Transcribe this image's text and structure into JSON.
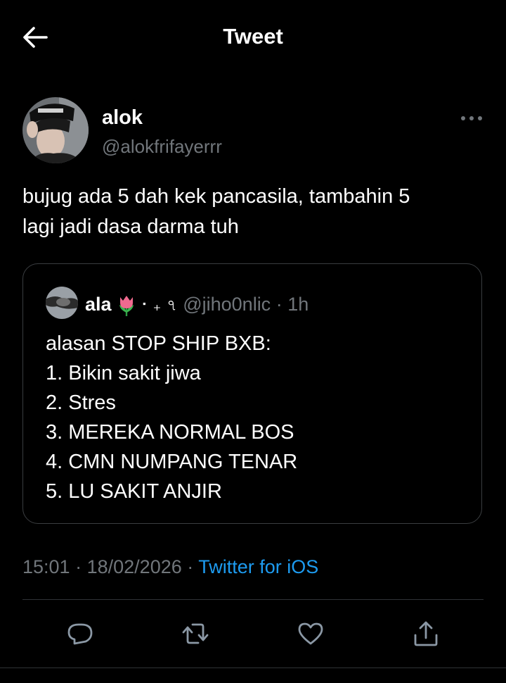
{
  "header": {
    "title": "Tweet",
    "back_icon": "arrow-left-icon"
  },
  "tweet": {
    "author": {
      "display_name": "alok",
      "handle": "@alokfrifayerrr"
    },
    "text_lines": [
      "bujug ada 5 dah kek pancasila, tambahin 5",
      "lagi jadi dasa darma tuh"
    ],
    "quoted": {
      "display_name": "ala",
      "name_decoration": "⠂₊ ৭",
      "emoji_icon": "tulip-icon",
      "handle": "@jiho0nlic",
      "separator": "·",
      "time": "1h",
      "lines": [
        "alasan STOP SHIP BXB:",
        "1. Bikin sakit jiwa",
        "2. Stres",
        "3. MEREKA NORMAL BOS",
        "4. CMN NUMPANG TENAR",
        "5. LU SAKIT ANJIR"
      ]
    },
    "meta": {
      "time": "15:01",
      "separator": "·",
      "date": "18/02/2026",
      "source": "Twitter for iOS"
    }
  },
  "actions": [
    "reply-icon",
    "retweet-icon",
    "like-icon",
    "share-icon"
  ],
  "colors": {
    "background": "#000000",
    "text": "#ffffff",
    "muted": "#71767b",
    "link": "#1d9bf0",
    "border": "#2f3336"
  }
}
